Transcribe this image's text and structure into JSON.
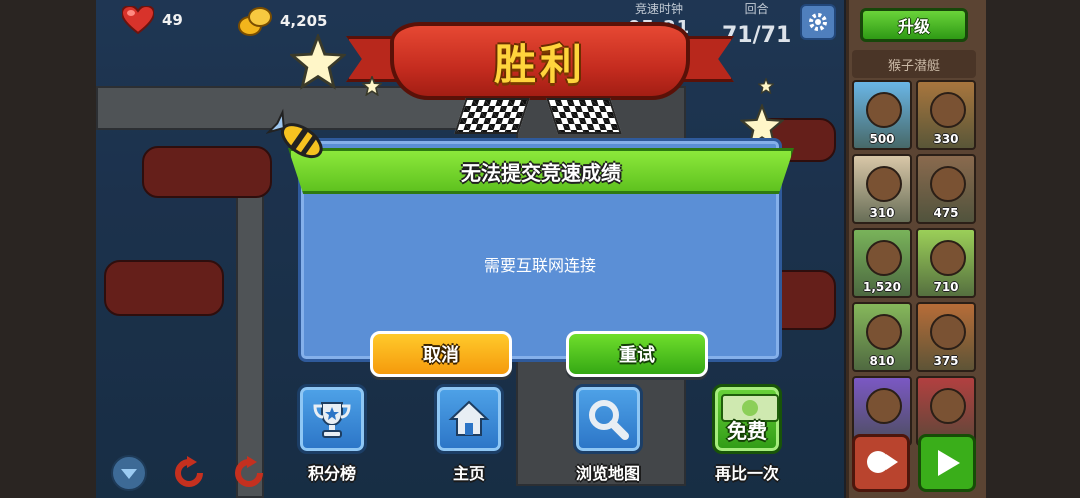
{
  "hud": {
    "lives": "49",
    "cash": "4,205",
    "race_timer_label": "竞速时钟",
    "race_timer_value": "05:21",
    "round_label": "回合",
    "round_value": "71/71",
    "settings_icon": "gear-icon"
  },
  "banner": {
    "title": "胜利"
  },
  "dialog": {
    "title": "无法提交竞速成绩",
    "message": "需要互联网连接",
    "cancel_label": "取消",
    "retry_label": "重试"
  },
  "actions": [
    {
      "label": "积分榜",
      "icon": "trophy-icon"
    },
    {
      "label": "主页",
      "icon": "home-icon"
    },
    {
      "label": "浏览地图",
      "icon": "magnifier-icon"
    },
    {
      "label": "再比一次",
      "badge": "免费",
      "icon": "cash-icon"
    }
  ],
  "side_panel": {
    "upgrade_label": "升级",
    "category_label": "猴子潜艇",
    "towers": [
      {
        "price": "500",
        "color": "#6ab6e6"
      },
      {
        "price": "330",
        "color": "#a8763e"
      },
      {
        "price": "310",
        "color": "#d9c7a8"
      },
      {
        "price": "475",
        "color": "#8a6a4e"
      },
      {
        "price": "1,520",
        "color": "#79b35a"
      },
      {
        "price": "710",
        "color": "#9bcf58"
      },
      {
        "price": "810",
        "color": "#86b85b"
      },
      {
        "price": "375",
        "color": "#b76d38"
      },
      {
        "price": "",
        "color": "#7b58c4"
      },
      {
        "price": "",
        "color": "#b24040"
      }
    ]
  },
  "colors": {
    "dialog_bg": "#5b8fd6",
    "header_green": "#5fc21f",
    "cancel_orange": "#f59a0c",
    "retry_green": "#35a814",
    "banner_red": "#c52c1f",
    "banner_text": "#ffd43c"
  }
}
